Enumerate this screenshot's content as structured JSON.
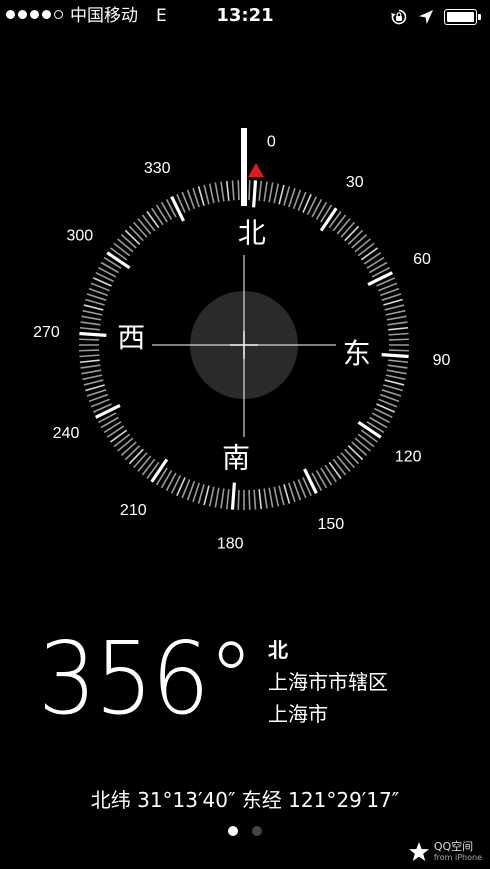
{
  "status_bar": {
    "signal_dots": [
      true,
      true,
      true,
      true,
      false
    ],
    "carrier": "中国移动",
    "network": "E",
    "time": "13:21",
    "icons": [
      "rotation-lock-icon",
      "location-arrow-icon",
      "battery-icon"
    ],
    "battery_level": 1.0
  },
  "compass": {
    "heading_degrees": 356,
    "degree_labels": [
      {
        "deg": 0,
        "text": "0"
      },
      {
        "deg": 30,
        "text": "30"
      },
      {
        "deg": 60,
        "text": "60"
      },
      {
        "deg": 90,
        "text": "90"
      },
      {
        "deg": 120,
        "text": "120"
      },
      {
        "deg": 150,
        "text": "150"
      },
      {
        "deg": 180,
        "text": "180"
      },
      {
        "deg": 210,
        "text": "210"
      },
      {
        "deg": 240,
        "text": "240"
      },
      {
        "deg": 270,
        "text": "270"
      },
      {
        "deg": 300,
        "text": "300"
      },
      {
        "deg": 330,
        "text": "330"
      }
    ],
    "cardinals": [
      {
        "deg": 0,
        "text": "北"
      },
      {
        "deg": 90,
        "text": "东"
      },
      {
        "deg": 180,
        "text": "南"
      },
      {
        "deg": 270,
        "text": "西"
      }
    ],
    "north_marker_color": "#e0191a"
  },
  "reading": {
    "heading_text": "356°",
    "direction": "北",
    "district": "上海市市辖区",
    "city": "上海市"
  },
  "coordinates": {
    "text": "北纬 31°13′40″  东经 121°29′17″"
  },
  "pagination": {
    "pages": 2,
    "current": 1
  },
  "watermark": {
    "title": "QQ空间",
    "subtitle": "from iPhone"
  }
}
